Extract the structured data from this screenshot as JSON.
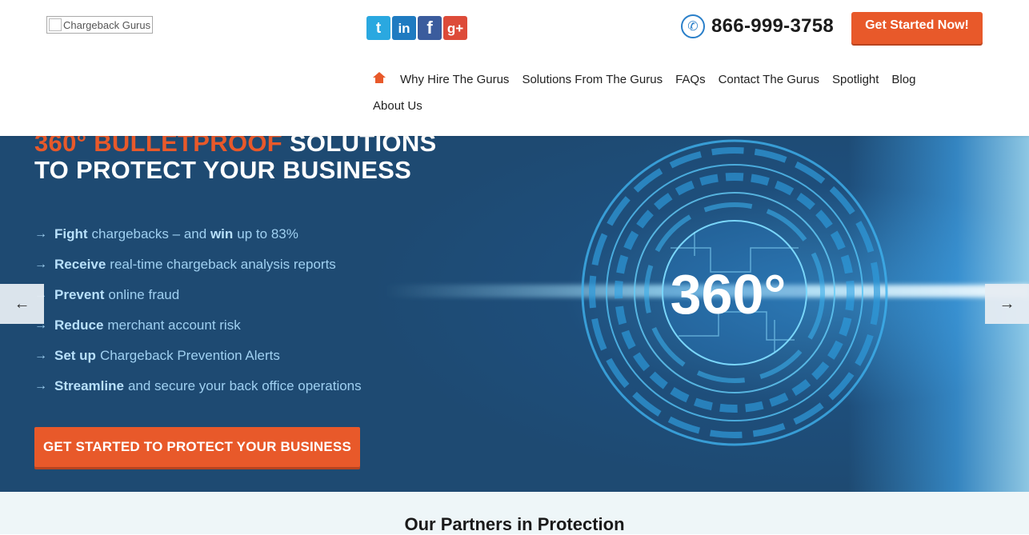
{
  "header": {
    "logo_alt": "Chargeback Gurus",
    "social": [
      {
        "name": "twitter-icon",
        "glyph": "t"
      },
      {
        "name": "linkedin-icon",
        "glyph": "in"
      },
      {
        "name": "facebook-icon",
        "glyph": "f"
      },
      {
        "name": "google-plus-icon",
        "glyph": "g+"
      }
    ],
    "phone": "866-999-3758",
    "cta": "Get Started Now!"
  },
  "nav": {
    "home_icon": "home-icon",
    "items": [
      "Why Hire The Gurus",
      "Solutions From The Gurus",
      "FAQs",
      "Contact The Gurus",
      "Spotlight",
      "Blog",
      "About Us"
    ]
  },
  "hero": {
    "title_accent": "360° BULLETPROOF",
    "title_rest": " SOLUTIONS",
    "title_line2": "TO PROTECT YOUR BUSINESS",
    "bullets": [
      {
        "bold": "Fight",
        "text": "chargebacks – and",
        "bold2": "win",
        "text2": "up to 83%"
      },
      {
        "bold": "Receive",
        "text": "real-time chargeback analysis reports"
      },
      {
        "bold": "Prevent",
        "text": "online fraud"
      },
      {
        "bold": "Reduce",
        "text": "merchant account risk"
      },
      {
        "bold": "Set up",
        "text": "Chargeback Prevention Alerts"
      },
      {
        "bold": "Streamline",
        "text": "and secure your back office operations"
      }
    ],
    "cta": "GET STARTED TO PROTECT YOUR BUSINESS",
    "badge": "360°",
    "prev_arrow": "←",
    "next_arrow": "→"
  },
  "partners": {
    "title": "Our Partners in Protection"
  },
  "colors": {
    "accent": "#e8592a",
    "hero_bg": "#1e4a72",
    "bullet_text": "#9fd0f1"
  }
}
